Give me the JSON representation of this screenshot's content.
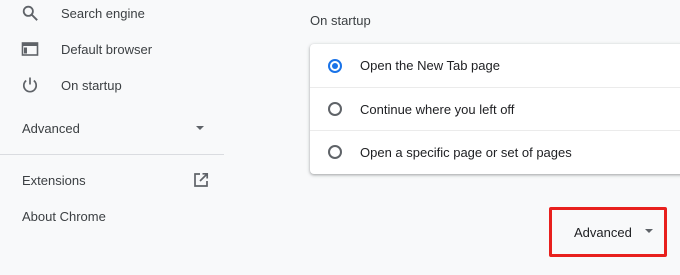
{
  "sidebar": {
    "items": [
      {
        "label": "Search engine",
        "icon": "search-icon"
      },
      {
        "label": "Default browser",
        "icon": "browser-window-icon"
      },
      {
        "label": "On startup",
        "icon": "power-icon"
      }
    ],
    "advanced_label": "Advanced",
    "extensions_label": "Extensions",
    "about_label": "About Chrome"
  },
  "main": {
    "section_title": "On startup",
    "options": [
      {
        "label": "Open the New Tab page",
        "checked": true
      },
      {
        "label": "Continue where you left off",
        "checked": false
      },
      {
        "label": "Open a specific page or set of pages",
        "checked": false
      }
    ],
    "advanced_button_label": "Advanced"
  },
  "colors": {
    "accent": "#1a73e8",
    "highlight_box": "#e8201d",
    "background": "#f8f9fa"
  }
}
